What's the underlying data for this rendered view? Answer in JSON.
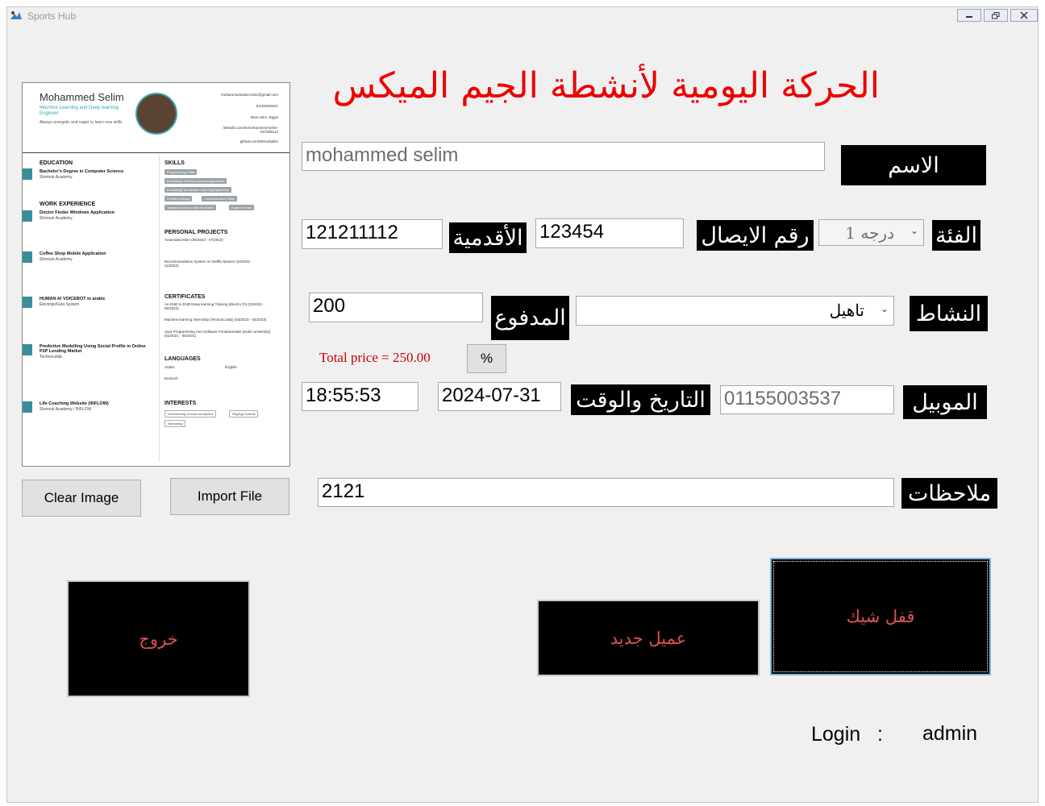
{
  "window": {
    "title": "Sports Hub",
    "controls": [
      "minimize",
      "restore",
      "close"
    ]
  },
  "heading": "الحركة اليومية لأنشطة الجيم الميكس",
  "fields": {
    "name": {
      "value": "mohammed selim",
      "label": "الاسم"
    },
    "seniority": {
      "value": "121211112",
      "label": "الأقدمية"
    },
    "receipt": {
      "value": "123454",
      "label": "رقم الايصال"
    },
    "category": {
      "value": "درجه 1",
      "label": "الفئة"
    },
    "paid": {
      "value": "200",
      "label": "المدفوع"
    },
    "activity": {
      "value": "تاهيل",
      "label": "النشاط"
    },
    "time": {
      "value": "18:55:53"
    },
    "date": {
      "value": "2024-07-31",
      "label": "التاريخ والوقت"
    },
    "mobile": {
      "value": "01155003537",
      "label": "الموبيل"
    },
    "notes": {
      "value": "2121",
      "label": "ملاحظات"
    }
  },
  "total_price": "Total price = 250.00",
  "percent_label": "%",
  "buttons": {
    "clear_image": "Clear Image",
    "import_file": "Import File",
    "exit": "خروج",
    "new_client": "عميل جديد",
    "lock_check": "قفل شيك"
  },
  "login": {
    "label": "Login   :",
    "user": "admin"
  },
  "colors": {
    "heading": "#ee0000",
    "total_price": "#cc0000",
    "big_button_text": "#e05050",
    "label_bg": "#000000",
    "cv_accent": "#3aa7b3"
  },
  "cv": {
    "name": "Mohammed Selim",
    "role": "Machine Learning and Deep learning Engineer",
    "tagline": "Always energetic and eager to learn new skills",
    "contacts": [
      "mohammedsalem1331@gmail.com",
      "01155003537",
      "New cairo, Egypt",
      "linkedin.com/in/mohammed-selim-187309144",
      "github.com/MOmdselim"
    ],
    "sections": {
      "education": "EDUCATION",
      "work": "WORK EXPERIENCE",
      "skills": "SKILLS",
      "projects": "PERSONAL PROJECTS",
      "certificates": "CERTIFICATES",
      "languages": "LANGUAGES",
      "interests": "INTERESTS"
    },
    "education": [
      {
        "title": "Bachelor's Degree in Computer Science",
        "org": "Shorouk Academy"
      }
    ],
    "work": [
      {
        "title": "Doctor Finder Windows Application",
        "org": "Shorouk Academy"
      },
      {
        "title": "Coffee Shop Mobile Application",
        "org": "Shorouk Academy"
      },
      {
        "title": "HUMAN AI VOICEBOT in arabic",
        "org": "Electropi/Giza System"
      },
      {
        "title": "Predictive Modelling Using Social Profile in Online P2P Lending Market",
        "org": "Technocolab"
      },
      {
        "title": "Life Coaching Website (INFLOW)",
        "org": "Shorouk Academy / INFLOW"
      }
    ],
    "skills": [
      "Programming Skills",
      "Knowledge of Deep Learning Algorithms",
      "Knowledge of Machine Learning Algorithms",
      "Problem solving",
      "Communication Skills",
      "Teamwork and conflict resolution",
      "Eager to learn"
    ],
    "projects": [
      "Automated EDA (06/2022 - 07/2022)",
      "Recommendation System on Netflix Movies (10/2022 - 11/2022)"
    ],
    "certificates": [
      "An END to END Deep learning Training (Electro Pi) (03/2022 - 06/2022)",
      "Machine learning internship (TechnoColab) (03/2023 - 04/2023)",
      "Java Programming And Software Fundamentals (Duke University) (02/2021 - 06/2021)"
    ],
    "languages": [
      "Arabic",
      "English",
      "Deutsch"
    ],
    "interests": [
      "Volunteering at local companies",
      "Playing Football",
      "Swimming"
    ]
  }
}
